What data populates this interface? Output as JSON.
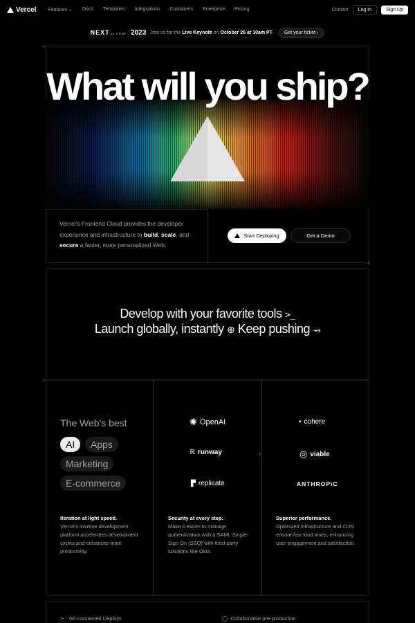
{
  "nav": {
    "brand": "Vercel",
    "links": [
      "Features",
      "Docs",
      "Templates",
      "Integrations",
      "Customers",
      "Enterprise",
      "Pricing"
    ],
    "features_chevron": "⌄",
    "contact": "Contact",
    "login": "Log In",
    "signup": "Sign Up"
  },
  "announcement": {
    "next_logo": "NEXT",
    "next_sup": ".js CONF",
    "year": "2023",
    "text_pre": "Join us for the",
    "keynote": "Live Keynote",
    "text_mid": "on",
    "date": "October 26 at 10am PT",
    "period": ".",
    "ticket": "Get your ticket",
    "ticket_arrow": "›"
  },
  "hero": {
    "title": "What will you ship?",
    "desc_1": "Vercel's Frontend Cloud provides the developer experience and infrastructure to",
    "build": "build",
    "comma1": ",",
    "scale": "scale",
    "comma2": ", and",
    "secure": "secure",
    "desc_2": "a faster, more personalized Web.",
    "start_button": "Start Deploying",
    "demo_button": "Get a Demo"
  },
  "develop": {
    "line1": "Develop with your favorite tools",
    "line1_icon": ">_",
    "line2a": "Launch globally, instantly",
    "line2_icon": "⊕",
    "line2b": "Keep pushing",
    "line2_icon2": "⥇"
  },
  "showcase": {
    "title": "The Web's best",
    "pills": [
      "AI",
      "Apps",
      "Marketing",
      "E-commerce"
    ],
    "active_pill": "AI",
    "logos": [
      {
        "name": "OpenAI",
        "icon": "✺"
      },
      {
        "name": "cohere",
        "icon": "▪"
      },
      {
        "name": "runway",
        "icon": "ℝ"
      },
      {
        "name": "viable",
        "icon": "◎"
      },
      {
        "name": "replicate",
        "icon": "▛"
      },
      {
        "name": "ANTHROP\\C",
        "icon": ""
      }
    ]
  },
  "features": [
    {
      "heading": "Iteration at light speed.",
      "body": "Vercel's intuitive development platform accelerates development cycles and enhances team productivity."
    },
    {
      "heading": "Security at every step.",
      "body": "Make it easier to manage authentication with a SAML Single-Sign On (SSO) with third-party solutions like Okta."
    },
    {
      "heading": "Superior performance.",
      "body": "Optimized infrastructure and CDN ensure fast load times, enhancing user engagement and satisfaction."
    }
  ],
  "bottom": {
    "deploys": "Git-connected Deploys",
    "deploys_icon": ">_",
    "preprod": "Collaborative pre-production",
    "preprod_icon": "◯"
  }
}
